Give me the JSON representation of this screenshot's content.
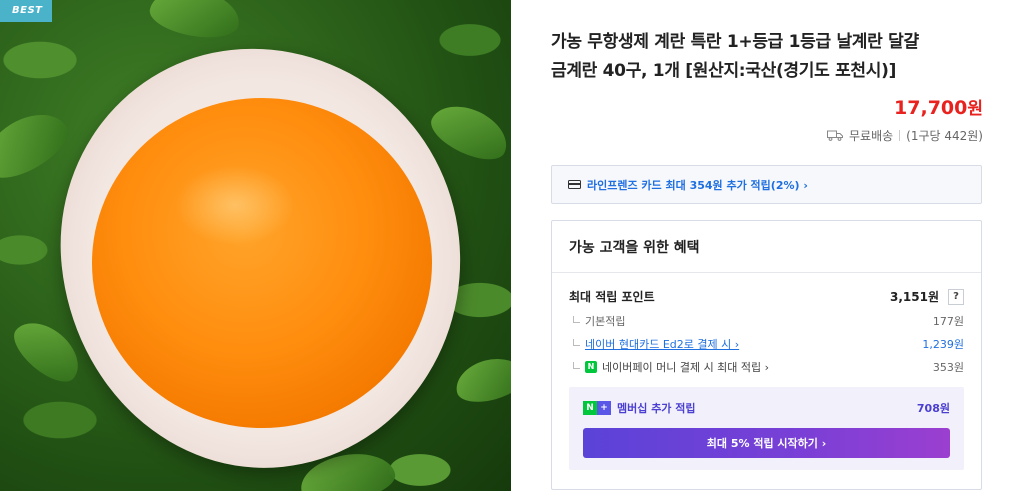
{
  "image": {
    "badge": "BEST"
  },
  "product": {
    "title_line1": "가농 무항생제 계란 특란 1+등급 1등급 날계란 달걀",
    "title_line2": "금계란 40구, 1개 [원산지:국산(경기도 포천시)]",
    "price": "17,700",
    "price_unit": "원",
    "shipping": "무료배송",
    "unit_price": "(1구당 442원)"
  },
  "card_banner": {
    "text": "라인프렌즈 카드 최대 354원 추가 적립(2%) ›"
  },
  "benefits": {
    "title": "가농 고객을 위한 혜택",
    "max_points_label": "최대 적립 포인트",
    "max_points_value": "3,151원",
    "help": "?",
    "rows": [
      {
        "label": "기본적립",
        "value": "177원"
      },
      {
        "label": "네이버 현대카드 Ed2로 결제 시 ›",
        "value": "1,239원"
      },
      {
        "badge": "N",
        "label": "네이버페이 머니 결제 시 최대 적립 ›",
        "value": "353원"
      }
    ],
    "membership": {
      "badge_n": "N",
      "badge_plus": "+",
      "label": "멤버십 추가 적립",
      "value": "708원",
      "cta": "최대 5% 적립 시작하기 ›"
    }
  },
  "colors": {
    "price": "#e8231f",
    "link_blue": "#1f6fe0",
    "membership_purple": "#4b3fd1",
    "cta_gradient_start": "#5b43d8",
    "cta_gradient_end": "#9b3fd0",
    "badge_teal": "#4bb3c9"
  },
  "icons": {
    "truck": "truck-icon",
    "card": "credit-card-icon",
    "npay": "naver-pay-icon",
    "nplus": "naver-plus-icon"
  }
}
